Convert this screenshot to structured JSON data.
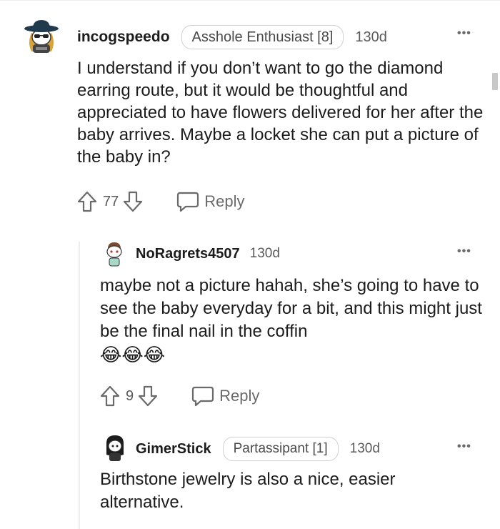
{
  "comments": [
    {
      "username": "incogspeedo",
      "flair": "Asshole Enthusiast [8]",
      "age": "130d",
      "body": "I understand if you don’t want to go the diamond earring route, but it would be thoughtful and appreciated to have flowers delivered for her after the baby arrives. Maybe a locket she can put a picture of the baby in?",
      "votes": "77",
      "reply_label": "Reply"
    },
    {
      "username": "NoRagrets4507",
      "age": "130d",
      "body": "maybe not a picture hahah, she’s going to have to see the baby everyday for a bit, and this might just be the final nail in the coffin",
      "emojis": "😂😂😂",
      "votes": "9",
      "reply_label": "Reply"
    },
    {
      "username": "GimerStick",
      "flair": "Partassipant [1]",
      "age": "130d",
      "body": "Birthstone jewelry is also a nice, easier alternative."
    }
  ],
  "more_label": "•••",
  "colors": {
    "text": "#1c1c1c",
    "muted": "#6a6a6a",
    "border": "#d0d0d0",
    "thread_line": "#ededed"
  },
  "icons": [
    "upvote-icon",
    "downvote-icon",
    "chat-bubble-icon",
    "more-options-icon"
  ]
}
